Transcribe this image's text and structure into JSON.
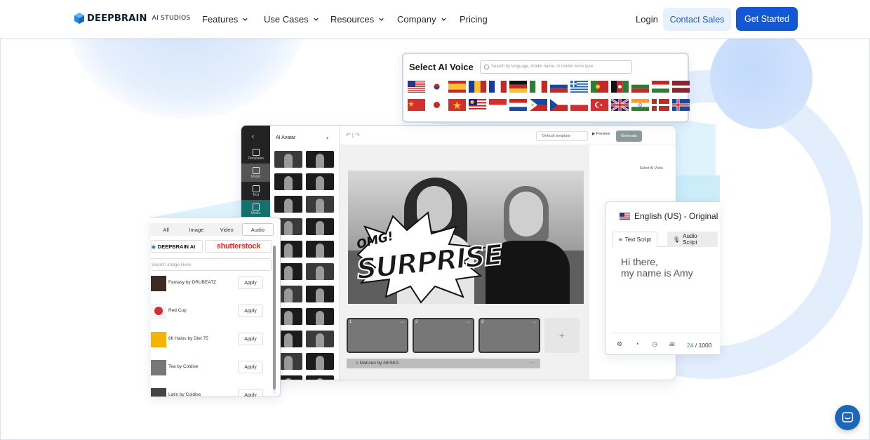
{
  "nav": {
    "logo_text": "DEEPBRAIN",
    "logo_sub": "AI STUDIOS",
    "menu": [
      {
        "label": "Features",
        "has_dropdown": true
      },
      {
        "label": "Use Cases",
        "has_dropdown": true
      },
      {
        "label": "Resources",
        "has_dropdown": true
      },
      {
        "label": "Company",
        "has_dropdown": true
      },
      {
        "label": "Pricing",
        "has_dropdown": false
      }
    ],
    "login": "Login",
    "contact_sales": "Contact Sales",
    "get_started": "Get Started"
  },
  "colors": {
    "primary": "#1258d5",
    "contact_bg": "#e6f0ff",
    "accent_light": "#c9defa",
    "chat": "#1d66b8"
  },
  "voice": {
    "title": "Select AI Voice",
    "search_placeholder": "Search by language, model name, or model voice type",
    "flags_row1": [
      "us",
      "kr",
      "es",
      "ro",
      "fr",
      "de",
      "it",
      "ru",
      "gr",
      "pt",
      "af",
      "bg",
      "hu",
      "lv"
    ],
    "flags_row2": [
      "cn",
      "jp",
      "vn",
      "my",
      "id",
      "nl",
      "ph",
      "cz",
      "pl",
      "tr",
      "gb",
      "in",
      "dk",
      "is"
    ]
  },
  "editor": {
    "panel_title": "AI Avatar",
    "rail": [
      "Templates",
      "Model",
      "Text",
      "Media"
    ],
    "default_template": "Default template",
    "preview": "Preview",
    "generate": "Generate",
    "select_voice": "Select AI Voice",
    "overlay_omg": "OMG!",
    "overlay_surprise": "SURPRISE",
    "scenes": [
      "1",
      "2",
      "3"
    ],
    "add_scene": "+",
    "music": "Mahzen by NESKA",
    "more": "···"
  },
  "media": {
    "tabs": [
      "All",
      "Image",
      "Video",
      "Audio"
    ],
    "active_tab": "Audio",
    "source_deepbrain": "DEEPBRAIN AI",
    "source_shutterstock": "shutterstock",
    "search_placeholder": "Search image Here",
    "apply_label": "Apply",
    "tracks": [
      "Fantasy by DRUBEATZ",
      "Red Cup",
      "66 Halos by Diet 75",
      "Tea by Coldise",
      "Latin by Coldise"
    ]
  },
  "script": {
    "language": "English (US) - Original V",
    "tab_text": "Text Script",
    "tab_audio": "Audio Script",
    "line1": "Hi there,",
    "line2": "my name is Amy",
    "count_current": "24",
    "count_total": "/ 1000"
  }
}
